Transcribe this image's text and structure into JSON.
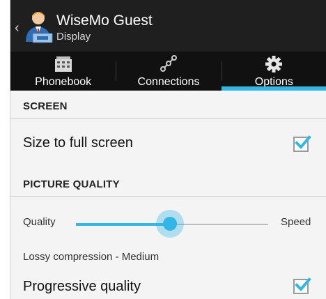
{
  "header": {
    "title": "WiseMo Guest",
    "subtitle": "Display",
    "back_icon": "chevron-left-icon",
    "app_icon": "guest-user-icon"
  },
  "tabs": [
    {
      "label": "Phonebook",
      "icon": "phonebook-icon",
      "active": false
    },
    {
      "label": "Connections",
      "icon": "connections-icon",
      "active": false
    },
    {
      "label": "Options",
      "icon": "gear-icon",
      "active": true
    }
  ],
  "sections": {
    "screen": {
      "header": "SCREEN",
      "size_to_full_screen": {
        "label": "Size to full screen",
        "checked": true
      }
    },
    "picture_quality": {
      "header": "PICTURE QUALITY",
      "slider": {
        "left_label": "Quality",
        "right_label": "Speed",
        "value": 0.49
      },
      "compression_text": "Lossy compression - Medium",
      "progressive_quality": {
        "label": "Progressive quality",
        "checked": true
      }
    }
  },
  "colors": {
    "accent": "#33b5e5",
    "actionbar": "#1f1f1f",
    "tabbar": "#111111",
    "background": "#f4f4f4"
  }
}
